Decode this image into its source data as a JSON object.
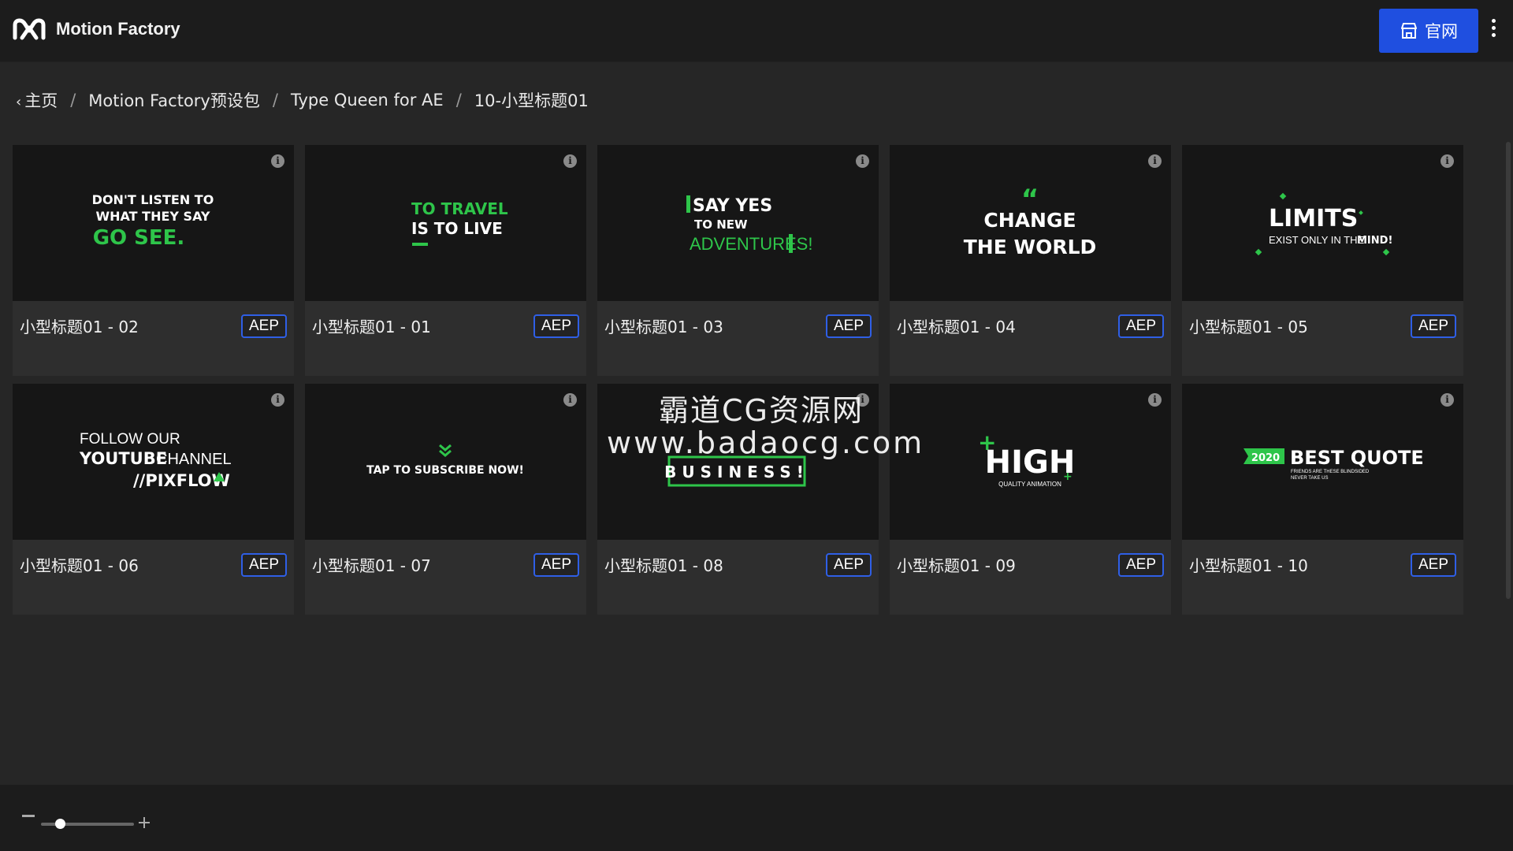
{
  "app": {
    "title": "Motion Factory"
  },
  "header": {
    "site_button_label": "官网",
    "accent": "#1f4fe0"
  },
  "breadcrumb": [
    "主页",
    "Motion Factory预设包",
    "Type Queen for AE",
    "10-小型标题01"
  ],
  "cards": [
    {
      "title": "小型标题01 - 02",
      "badge": "AEP",
      "preview": [
        "DON'T LISTEN TO",
        "WHAT THEY SAY",
        "GO SEE."
      ]
    },
    {
      "title": "小型标题01 - 01",
      "badge": "AEP",
      "preview": [
        "TO TRAVEL",
        "IS TO LIVE"
      ]
    },
    {
      "title": "小型标题01 - 03",
      "badge": "AEP",
      "preview": [
        "SAY YES",
        "TO NEW",
        "ADVENTURES!"
      ]
    },
    {
      "title": "小型标题01 - 04",
      "badge": "AEP",
      "preview": [
        "CHANGE",
        "THE WORLD"
      ]
    },
    {
      "title": "小型标题01 - 05",
      "badge": "AEP",
      "preview": [
        "LIMITS",
        "EXIST ONLY IN THE",
        "MIND!"
      ]
    },
    {
      "title": "小型标题01 - 06",
      "badge": "AEP",
      "preview": [
        "FOLLOW OUR",
        "YOUTUBE",
        "CHANNEL",
        "//PIXFLOW"
      ]
    },
    {
      "title": "小型标题01 - 07",
      "badge": "AEP",
      "preview": [
        "TAP TO SUBSCRIBE NOW!"
      ]
    },
    {
      "title": "小型标题01 - 08",
      "badge": "AEP",
      "preview": [
        "BUSINESS!"
      ]
    },
    {
      "title": "小型标题01 - 09",
      "badge": "AEP",
      "preview": [
        "HIGH",
        "QUALITY ANIMATION"
      ]
    },
    {
      "title": "小型标题01 - 10",
      "badge": "AEP",
      "preview": [
        "2020",
        "BEST QUOTE",
        "FRIENDS ARE THESE BLINDSIDED",
        "NEVER TAKE US"
      ]
    }
  ],
  "watermark": {
    "line1": "霸道CG资源网",
    "line2": "www.badaocg.com"
  },
  "zoom": {
    "level": 0.2
  },
  "colors": {
    "accent_green": "#2ec54a",
    "badge_border": "#2f5fe6"
  }
}
